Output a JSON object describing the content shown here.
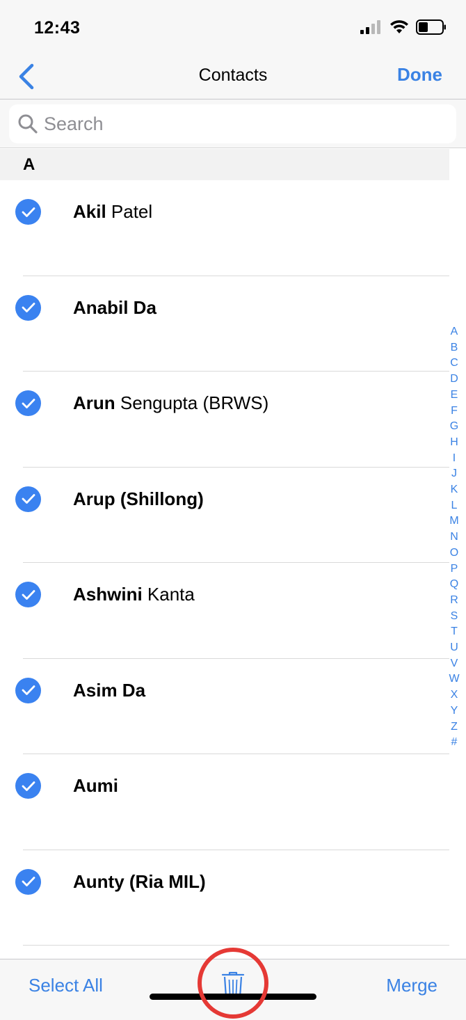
{
  "status_bar": {
    "time": "12:43",
    "icons": [
      "signal-icon",
      "wifi-icon",
      "battery-icon"
    ]
  },
  "nav": {
    "back_icon": "chevron-left-icon",
    "title": "Contacts",
    "done_label": "Done"
  },
  "search": {
    "placeholder": "Search",
    "value": ""
  },
  "section": {
    "letter": "A"
  },
  "contacts": [
    {
      "first": "Akil",
      "rest": " Patel",
      "selected": true
    },
    {
      "first": "Anabil Da",
      "rest": "",
      "selected": true
    },
    {
      "first": "Arun",
      "rest": " Sengupta (BRWS)",
      "selected": true
    },
    {
      "first": "Arup (Shillong)",
      "rest": "",
      "selected": true
    },
    {
      "first": "Ashwini",
      "rest": " Kanta",
      "selected": true
    },
    {
      "first": "Asim Da",
      "rest": "",
      "selected": true
    },
    {
      "first": "Aumi",
      "rest": "",
      "selected": true
    },
    {
      "first": "Aunty (Ria MIL)",
      "rest": "",
      "selected": true
    }
  ],
  "index_letters": [
    "A",
    "B",
    "C",
    "D",
    "E",
    "F",
    "G",
    "H",
    "I",
    "J",
    "K",
    "L",
    "M",
    "N",
    "O",
    "P",
    "Q",
    "R",
    "S",
    "T",
    "U",
    "V",
    "W",
    "X",
    "Y",
    "Z",
    "#"
  ],
  "toolbar": {
    "select_all_label": "Select All",
    "merge_label": "Merge",
    "trash_icon": "trash-icon"
  },
  "colors": {
    "accent": "#3a82e4",
    "highlight": "#e53935"
  }
}
